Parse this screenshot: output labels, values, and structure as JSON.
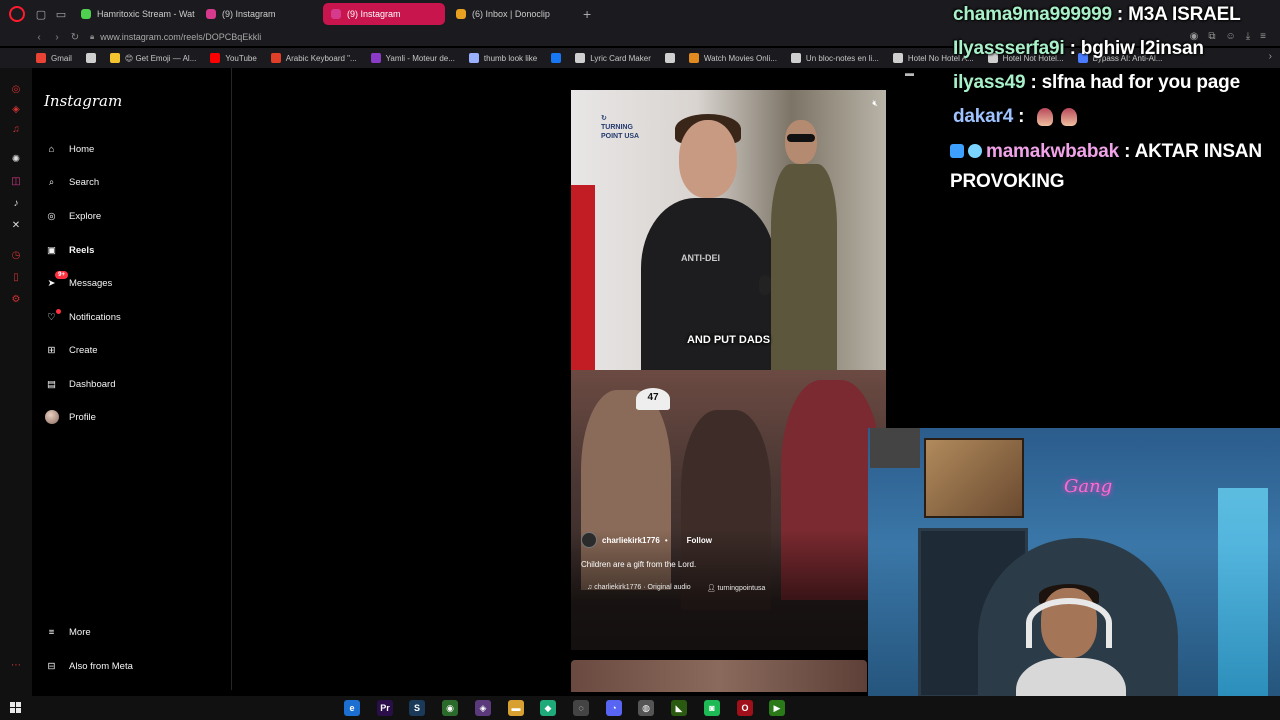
{
  "browser": {
    "tabs": [
      {
        "title": "Hamritoxic Stream - Watc",
        "fav": "#4fd14f"
      },
      {
        "title": "(9) Instagram",
        "fav": "#d63a8c"
      },
      {
        "title": "(9) Instagram",
        "fav": "#d63a8c",
        "active": true
      },
      {
        "title": "(6) Inbox | Donoclip",
        "fav": "#e8a020"
      }
    ],
    "new_tab": "+",
    "url": "www.instagram.com/reels/DOPCBqEkkli",
    "bookmarks": [
      {
        "label": "Gmail",
        "color": "#ea4335"
      },
      {
        "label": "",
        "color": "#cfcfcf"
      },
      {
        "label": "😊 Get Emoji — Al...",
        "color": "#f4c430"
      },
      {
        "label": "YouTube",
        "color": "#ff0000"
      },
      {
        "label": "Arabic Keyboard \"...",
        "color": "#e0402a"
      },
      {
        "label": "Yamli - Moteur de...",
        "color": "#8a3cc8"
      },
      {
        "label": "thumb look like",
        "color": "#9ab0ff"
      },
      {
        "label": "",
        "color": "#1877f2"
      },
      {
        "label": "Lyric Card Maker",
        "color": "#cfcfcf"
      },
      {
        "label": "",
        "color": "#cfcfcf"
      },
      {
        "label": "Watch Movies Onli...",
        "color": "#e08a20"
      },
      {
        "label": "Un bloc-notes en li...",
        "color": "#cfcfcf"
      },
      {
        "label": "Hotel No Hotel A...",
        "color": "#cfcfcf"
      },
      {
        "label": "Hotel Not Hotel...",
        "color": "#cfcfcf"
      },
      {
        "label": "Bypass AI: Anti-Al...",
        "color": "#4a7cff"
      }
    ]
  },
  "instagram": {
    "logo": "Instagram",
    "nav": [
      {
        "label": "Home",
        "icon": "home-icon",
        "glyph": "⌂"
      },
      {
        "label": "Search",
        "icon": "search-icon",
        "glyph": "⌕"
      },
      {
        "label": "Explore",
        "icon": "compass-icon",
        "glyph": "◎"
      },
      {
        "label": "Reels",
        "icon": "reels-icon",
        "glyph": "▣",
        "bold": true
      },
      {
        "label": "Messages",
        "icon": "messenger-icon",
        "glyph": "➤",
        "badge": "9+"
      },
      {
        "label": "Notifications",
        "icon": "heart-icon",
        "glyph": "♡",
        "dot": true
      },
      {
        "label": "Create",
        "icon": "plus-square-icon",
        "glyph": "⊞"
      },
      {
        "label": "Dashboard",
        "icon": "dashboard-icon",
        "glyph": "▤"
      },
      {
        "label": "Profile",
        "icon": "avatar",
        "glyph": ""
      }
    ],
    "more": "More",
    "also_from_meta": "Also from Meta",
    "reel": {
      "subtitle": "AND PUT DADS",
      "username": "charliekirk1776",
      "separator": "•",
      "follow": "Follow",
      "description": "Children are a gift from the Lord.",
      "audio": "charliekirk1776 · Original audio",
      "tagged": "turningpointusa",
      "cap_text": "47",
      "shirt_text": "ANTI-DEI"
    }
  },
  "chat": [
    {
      "user": "chama9ma999999",
      "sep": " : ",
      "msg": "M3A ISRAEL",
      "color": "green"
    },
    {
      "user": "Ilyassserfa9i",
      "sep": " : ",
      "msg": "bghiw l2insan",
      "color": "green"
    },
    {
      "user": "ilyass49",
      "sep": " : ",
      "msg": "slfna had for you page",
      "color": "green"
    },
    {
      "user": "dakar4",
      "sep": " : ",
      "msg": "",
      "color": "blue",
      "emotes": 2
    },
    {
      "user": "mamakwbabak",
      "sep": " : ",
      "msg": "AKTAR INSAN PROVOKING",
      "color": "pink"
    }
  ],
  "webcam": {
    "neon_sign": "Gang"
  },
  "taskbar": {
    "apps": [
      {
        "name": "edge-icon",
        "glyph": "e",
        "bg": "#1b6fd0"
      },
      {
        "name": "premiere-icon",
        "glyph": "Pr",
        "bg": "#2a0e4a"
      },
      {
        "name": "steam-icon",
        "glyph": "S",
        "bg": "#1b3a5a"
      },
      {
        "name": "chrome-icon",
        "glyph": "◉",
        "bg": "#2a6a2a"
      },
      {
        "name": "app-icon",
        "glyph": "◈",
        "bg": "#5a3a7a"
      },
      {
        "name": "folder-icon",
        "glyph": "▬",
        "bg": "#d8a030"
      },
      {
        "name": "app2-icon",
        "glyph": "◆",
        "bg": "#1faa7a"
      },
      {
        "name": "app3-icon",
        "glyph": "◌",
        "bg": "#444"
      },
      {
        "name": "discord-icon",
        "glyph": "◔",
        "bg": "#5865f2"
      },
      {
        "name": "app4-icon",
        "glyph": "◍",
        "bg": "#555"
      },
      {
        "name": "nvidia-icon",
        "glyph": "◣",
        "bg": "#2a5a10"
      },
      {
        "name": "spotify-icon",
        "glyph": "◙",
        "bg": "#1db954"
      },
      {
        "name": "opera-icon",
        "glyph": "O",
        "bg": "#a0101a"
      },
      {
        "name": "kick-icon",
        "glyph": "▶",
        "bg": "#2a7a1a"
      }
    ]
  }
}
